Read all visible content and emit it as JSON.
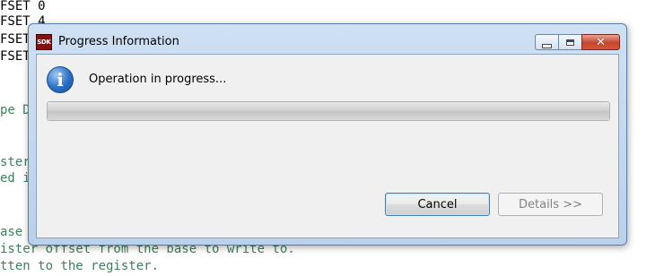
{
  "background_editor": {
    "lines": [
      {
        "text": "FSET 0"
      },
      {
        "text": "FSET 4"
      },
      {
        "text": "FSET"
      },
      {
        "text": "FSET"
      },
      {
        "text": "pe D"
      },
      {
        "text": "ster."
      },
      {
        "text": "ed i"
      },
      {
        "text": "ase"
      },
      {
        "text": "ister offset from the base to write to."
      },
      {
        "text": "tten to the register."
      }
    ]
  },
  "dialog": {
    "title": "Progress Information",
    "app_icon_text": "SDK",
    "window_controls": {
      "close_glyph": "✕"
    },
    "info_icon_glyph": "i",
    "message": "Operation in progress...",
    "progress": {
      "value_percent": 100,
      "state": "indeterminate"
    },
    "buttons": {
      "cancel_label": "Cancel",
      "details_label": "Details >>"
    }
  },
  "colors": {
    "title_gradient": "#cfe0f3",
    "close_button": "#c4462d",
    "info_icon": "#2a6fc4",
    "comment_text": "#3f7f5f"
  }
}
